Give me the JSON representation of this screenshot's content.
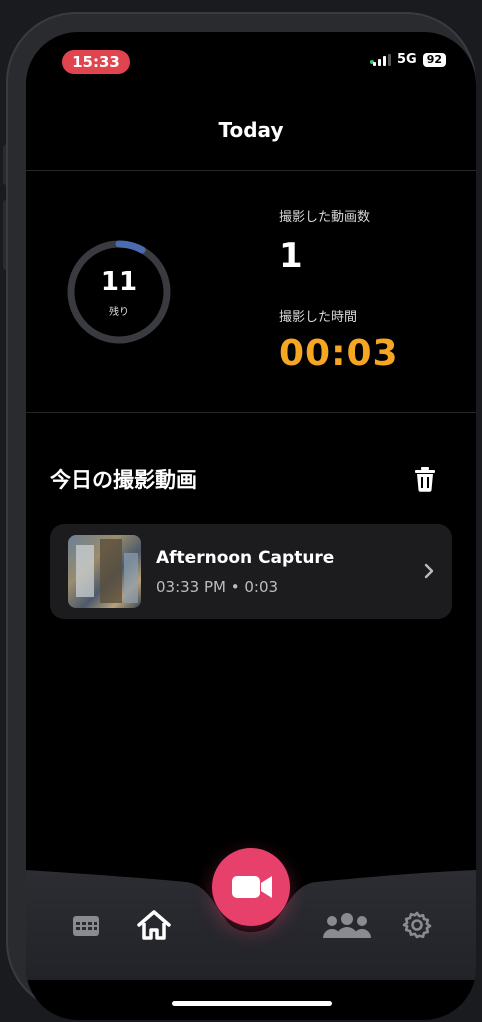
{
  "status_bar": {
    "time": "15:33",
    "network": "5G",
    "battery": "92"
  },
  "header": {
    "title": "Today"
  },
  "summary": {
    "remaining_count": "11",
    "remaining_label": "残り",
    "remaining_progress": 0.08,
    "videos_label": "撮影した動画数",
    "videos_count": "1",
    "duration_label": "撮影した時間",
    "duration_value": "00:03"
  },
  "videos_section": {
    "title": "今日の撮影動画",
    "items": [
      {
        "title": "Afternoon Capture",
        "meta": "03:33 PM • 0:03"
      }
    ]
  },
  "tab_bar": {
    "items": [
      "calendar-icon",
      "home-icon",
      "record-button",
      "people-icon",
      "gear-icon"
    ],
    "accent": "#e6406b"
  },
  "colors": {
    "duration": "#f5a623",
    "time_pill": "#e0444e",
    "ring_progress": "#4a6bb0"
  }
}
